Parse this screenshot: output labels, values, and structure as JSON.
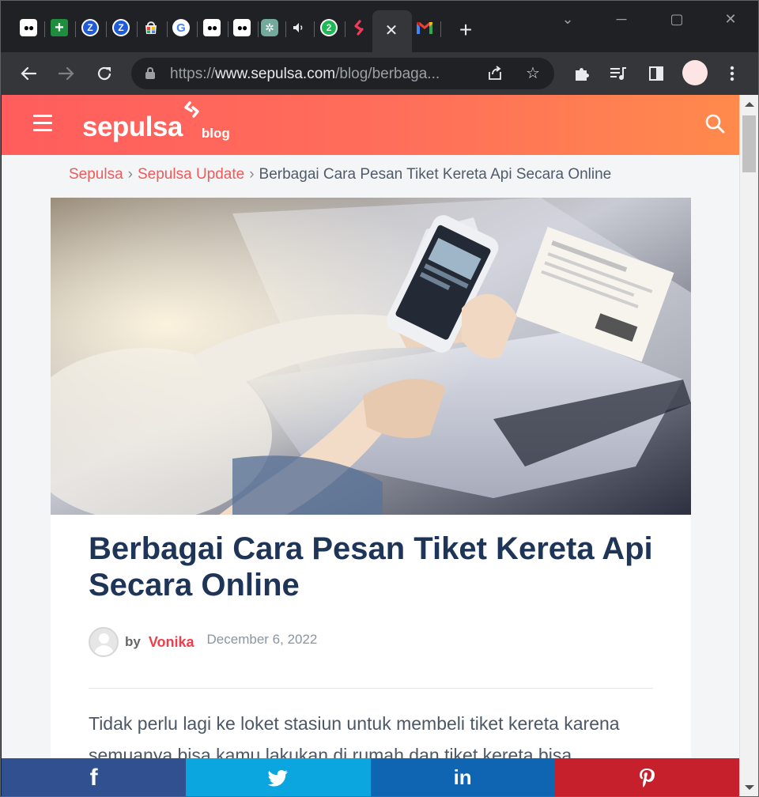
{
  "browser": {
    "tabs": [
      {
        "icon": "medium-icon",
        "glyph": "●●"
      },
      {
        "icon": "google-sheets-icon",
        "glyph": "+"
      },
      {
        "icon": "zoho-icon",
        "glyph": "Z"
      },
      {
        "icon": "zoho-icon",
        "glyph": "Z"
      },
      {
        "icon": "web-store-icon",
        "glyph": ""
      },
      {
        "icon": "google-icon",
        "glyph": "G"
      },
      {
        "icon": "medium-icon",
        "glyph": "●●"
      },
      {
        "icon": "medium-icon",
        "glyph": "●●"
      },
      {
        "icon": "chatgpt-icon",
        "glyph": "✲"
      },
      {
        "icon": "audio-icon",
        "glyph": "🔈"
      },
      {
        "icon": "notification-icon",
        "glyph": "2"
      },
      {
        "icon": "sepulsa-icon",
        "glyph": "S"
      }
    ],
    "url_scheme": "https://",
    "url_host": "www.sepulsa.com",
    "url_path": "/blog/berbaga..."
  },
  "site": {
    "logo_text": "sepulsa",
    "logo_suffix": "blog",
    "brand_color": "#ff5d5d"
  },
  "breadcrumb": {
    "home": "Sepulsa",
    "category": "Sepulsa Update",
    "current": "Berbagai Cara Pesan Tiket Kereta Api Secara Online"
  },
  "article": {
    "title": "Berbagai Cara Pesan Tiket Kereta Api Secara Online",
    "by_label": "by",
    "author": "Vonika",
    "date": "December 6, 2022",
    "intro": "Tidak perlu lagi ke loket stasiun untuk membeli tiket kereta karena semuanya bisa kamu lakukan di rumah dan tiket kereta bisa"
  },
  "share": {
    "facebook": "f",
    "twitter": "twitter",
    "linkedin": "in",
    "pinterest": "P"
  }
}
